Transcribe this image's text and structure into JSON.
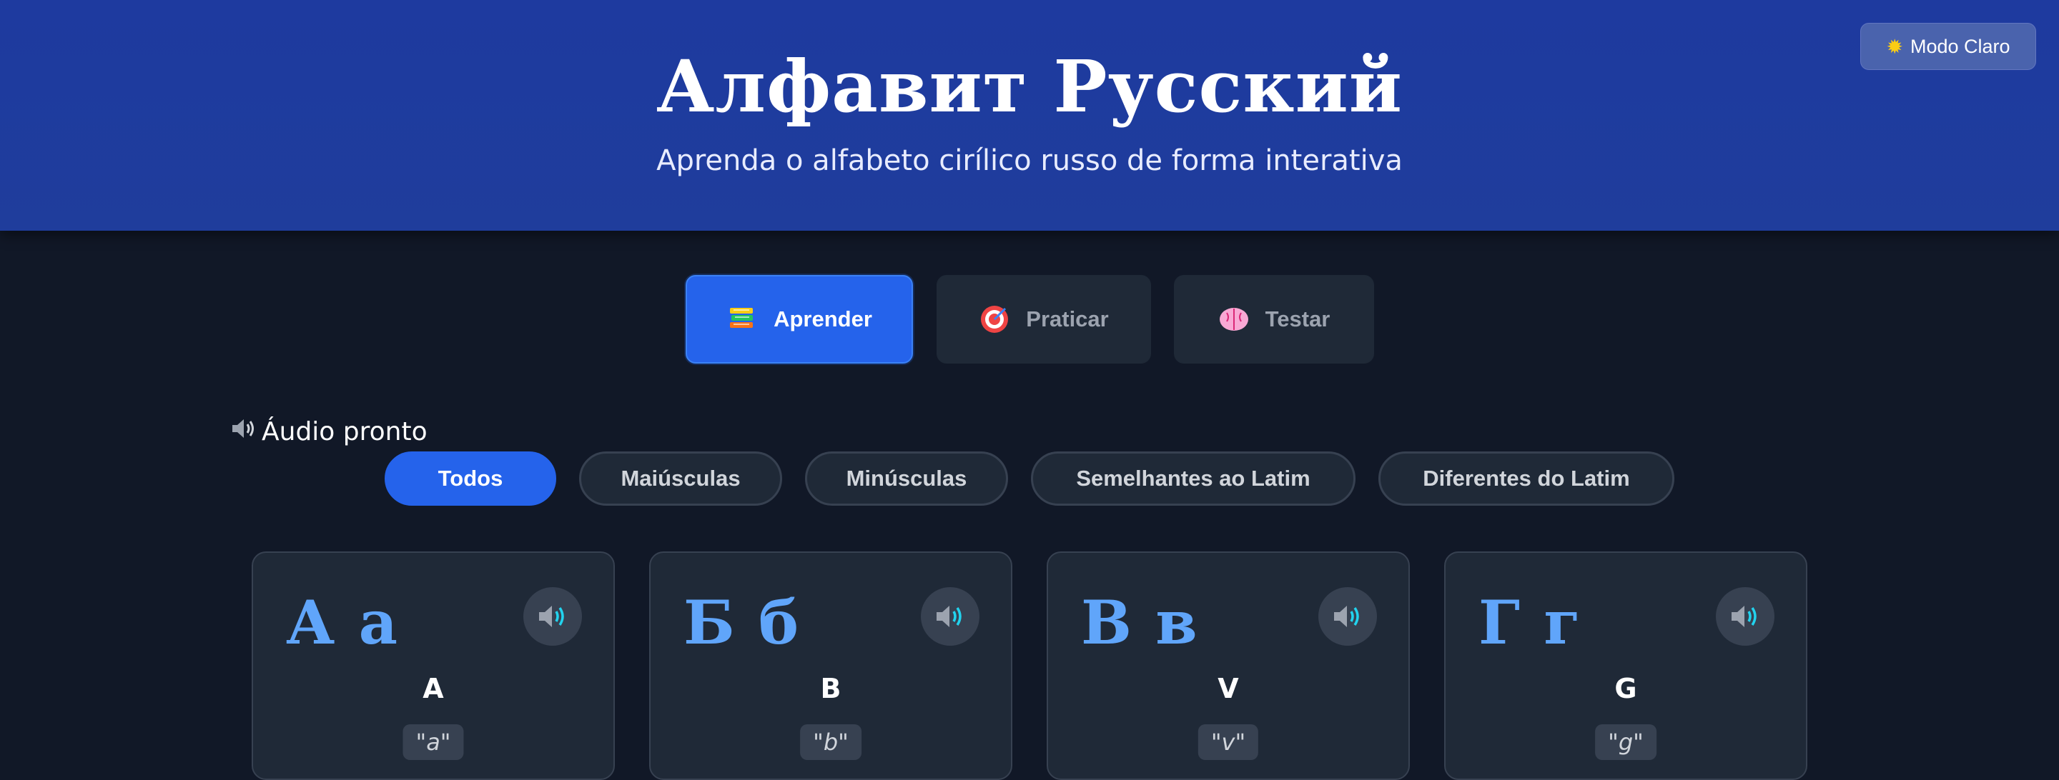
{
  "header": {
    "title": "Алфавит Русский",
    "subtitle": "Aprenda o alfabeto cirílico russo de forma interativa",
    "theme_toggle": {
      "icon": "sun-icon",
      "label": "Modo Claro"
    }
  },
  "modes": [
    {
      "label": "Aprender",
      "icon": "books-icon",
      "active": true
    },
    {
      "label": "Praticar",
      "icon": "target-icon",
      "active": false
    },
    {
      "label": "Testar",
      "icon": "brain-icon",
      "active": false
    }
  ],
  "audio_status": {
    "icon": "speaker-icon",
    "label": "Áudio pronto"
  },
  "filters": [
    {
      "label": "Todos",
      "active": true
    },
    {
      "label": "Maiúsculas",
      "active": false
    },
    {
      "label": "Minúsculas",
      "active": false
    },
    {
      "label": "Semelhantes ao Latim",
      "active": false
    },
    {
      "label": "Diferentes do Latim",
      "active": false
    }
  ],
  "cards": [
    {
      "letter": "А а",
      "name": "A",
      "pron": "\"a\""
    },
    {
      "letter": "Б б",
      "name": "B",
      "pron": "\"b\""
    },
    {
      "letter": "В в",
      "name": "V",
      "pron": "\"v\""
    },
    {
      "letter": "Г г",
      "name": "G",
      "pron": "\"g\""
    }
  ],
  "colors": {
    "header_bg": "#1e3a9f",
    "page_bg": "#111827",
    "accent": "#2563eb",
    "letter": "#60a5fa",
    "card_bg": "#1f2937"
  }
}
